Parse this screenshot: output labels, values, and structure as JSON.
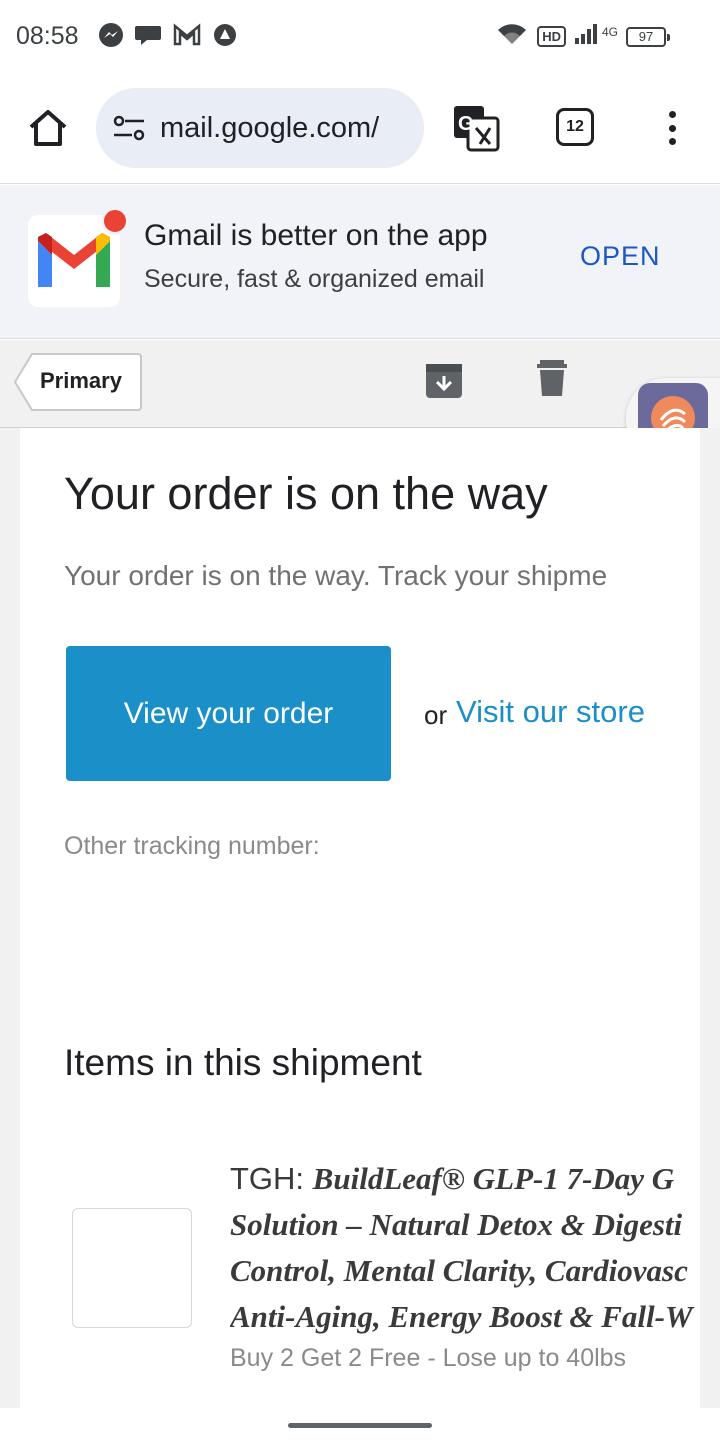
{
  "status_bar": {
    "time": "08:58",
    "network": "4G",
    "hd": "HD",
    "battery": "97",
    "icons_left": [
      "messenger-icon",
      "chat-icon",
      "gmail-icon",
      "vpn-icon"
    ],
    "icons_right": [
      "wifi-icon",
      "hd-icon",
      "signal-icon",
      "battery-icon"
    ]
  },
  "browser": {
    "url": "mail.google.com/",
    "tab_count": "12"
  },
  "app_banner": {
    "title": "Gmail is better on the app",
    "subtitle": "Secure, fast & organized email",
    "open_label": "OPEN"
  },
  "mail_bar": {
    "back_label": "Primary"
  },
  "email": {
    "title": "Your order is on the way",
    "preview": "Your order is on the way. Track your shipme",
    "view_order_label": "View your order",
    "or_text": "or",
    "visit_store_label": "Visit our store",
    "tracking_label": "Other tracking number:",
    "items_heading": "Items in this shipment",
    "item": {
      "prefix": "TGH: ",
      "title_lines": [
        "BuildLeaf® GLP-1 7-Day G",
        "Solution – Natural Detox & Digesti",
        "Control, Mental Clarity, Cardiovasc",
        "Anti-Aging, Energy Boost & Fall-W"
      ],
      "subtitle": "Buy 2 Get 2 Free - Lose up to 40lbs"
    }
  },
  "colors": {
    "accent_blue": "#1a8fc8",
    "banner_open": "#1a57c7",
    "gmail_red": "#ea4335"
  }
}
